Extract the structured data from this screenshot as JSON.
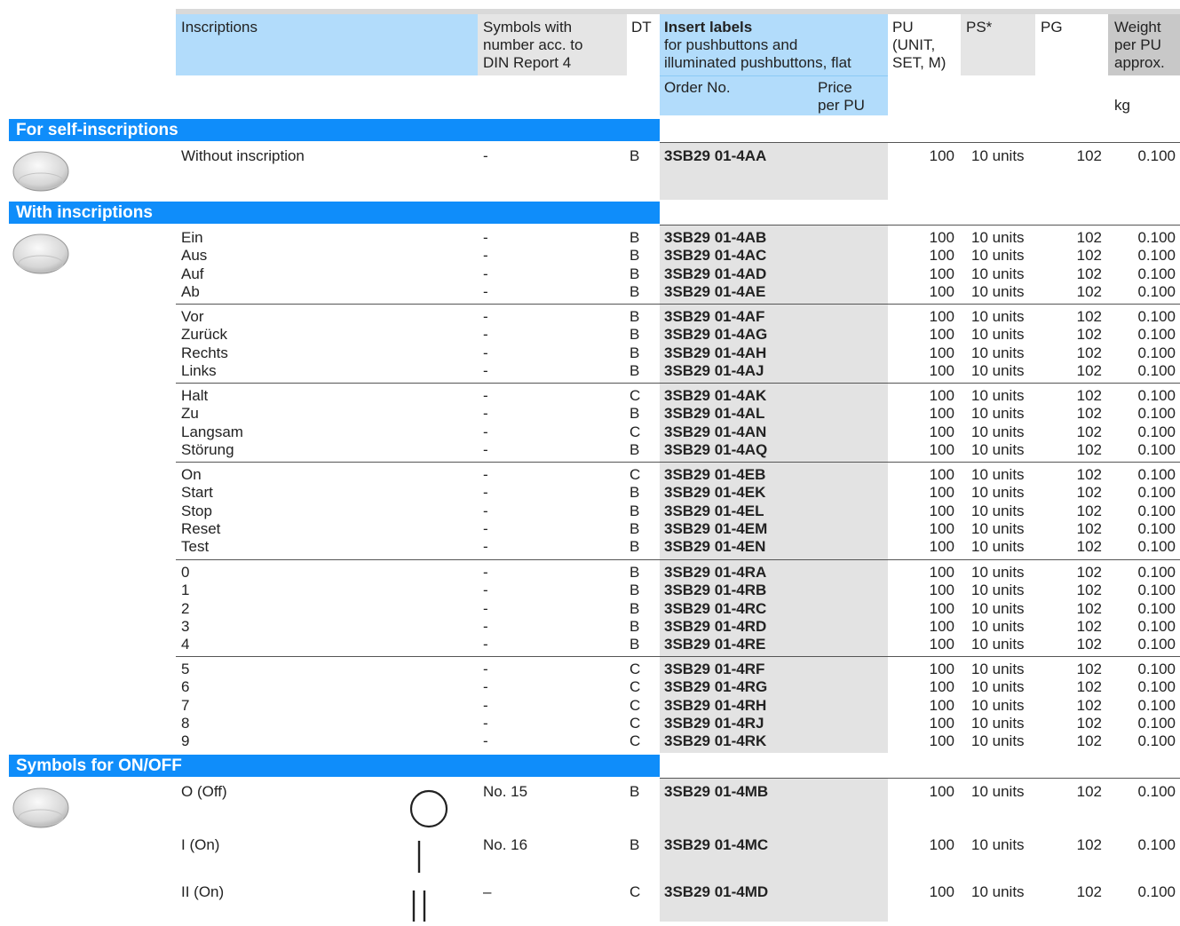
{
  "header": {
    "inscriptions": "Inscriptions",
    "symbols": [
      "Symbols with",
      "number acc. to",
      "DIN Report 4"
    ],
    "dt": "DT",
    "insert_title": "Insert labels",
    "insert_sub": [
      "for pushbuttons and",
      "illuminated pushbuttons, flat"
    ],
    "pu": [
      "PU",
      "(UNIT,",
      "SET, M)"
    ],
    "ps": "PS*",
    "pg": "PG",
    "weight": [
      "Weight",
      "per PU",
      "approx."
    ],
    "order_no": "Order No.",
    "price": [
      "Price",
      "per PU"
    ],
    "kg": "kg"
  },
  "sections": {
    "self": "For self-inscriptions",
    "with": "With inscriptions",
    "symbols": "Symbols for ON/OFF"
  },
  "self_row": {
    "ins": "Without inscription",
    "sym": "-",
    "dt": "B",
    "ord": "3SB29 01-4AA",
    "pu": "100",
    "ps": "10 units",
    "pg": "102",
    "wt": "0.100"
  },
  "groups": [
    [
      {
        "ins": "Ein",
        "sym": "-",
        "dt": "B",
        "ord": "3SB29 01-4AB",
        "pu": "100",
        "ps": "10 units",
        "pg": "102",
        "wt": "0.100"
      },
      {
        "ins": "Aus",
        "sym": "-",
        "dt": "B",
        "ord": "3SB29 01-4AC",
        "pu": "100",
        "ps": "10 units",
        "pg": "102",
        "wt": "0.100"
      },
      {
        "ins": "Auf",
        "sym": "-",
        "dt": "B",
        "ord": "3SB29 01-4AD",
        "pu": "100",
        "ps": "10 units",
        "pg": "102",
        "wt": "0.100"
      },
      {
        "ins": "Ab",
        "sym": "-",
        "dt": "B",
        "ord": "3SB29 01-4AE",
        "pu": "100",
        "ps": "10 units",
        "pg": "102",
        "wt": "0.100"
      }
    ],
    [
      {
        "ins": "Vor",
        "sym": "-",
        "dt": "B",
        "ord": "3SB29 01-4AF",
        "pu": "100",
        "ps": "10 units",
        "pg": "102",
        "wt": "0.100"
      },
      {
        "ins": "Zurück",
        "sym": "-",
        "dt": "B",
        "ord": "3SB29 01-4AG",
        "pu": "100",
        "ps": "10 units",
        "pg": "102",
        "wt": "0.100"
      },
      {
        "ins": "Rechts",
        "sym": "-",
        "dt": "B",
        "ord": "3SB29 01-4AH",
        "pu": "100",
        "ps": "10 units",
        "pg": "102",
        "wt": "0.100"
      },
      {
        "ins": "Links",
        "sym": "-",
        "dt": "B",
        "ord": "3SB29 01-4AJ",
        "pu": "100",
        "ps": "10 units",
        "pg": "102",
        "wt": "0.100"
      }
    ],
    [
      {
        "ins": "Halt",
        "sym": "-",
        "dt": "C",
        "ord": "3SB29 01-4AK",
        "pu": "100",
        "ps": "10 units",
        "pg": "102",
        "wt": "0.100"
      },
      {
        "ins": "Zu",
        "sym": "-",
        "dt": "B",
        "ord": "3SB29 01-4AL",
        "pu": "100",
        "ps": "10 units",
        "pg": "102",
        "wt": "0.100"
      },
      {
        "ins": "Langsam",
        "sym": "-",
        "dt": "C",
        "ord": "3SB29 01-4AN",
        "pu": "100",
        "ps": "10 units",
        "pg": "102",
        "wt": "0.100"
      },
      {
        "ins": "Störung",
        "sym": "-",
        "dt": "B",
        "ord": "3SB29 01-4AQ",
        "pu": "100",
        "ps": "10 units",
        "pg": "102",
        "wt": "0.100"
      }
    ],
    [
      {
        "ins": "On",
        "sym": "-",
        "dt": "C",
        "ord": "3SB29 01-4EB",
        "pu": "100",
        "ps": "10 units",
        "pg": "102",
        "wt": "0.100"
      },
      {
        "ins": "Start",
        "sym": "-",
        "dt": "B",
        "ord": "3SB29 01-4EK",
        "pu": "100",
        "ps": "10 units",
        "pg": "102",
        "wt": "0.100"
      },
      {
        "ins": "Stop",
        "sym": "-",
        "dt": "B",
        "ord": "3SB29 01-4EL",
        "pu": "100",
        "ps": "10 units",
        "pg": "102",
        "wt": "0.100"
      },
      {
        "ins": "Reset",
        "sym": "-",
        "dt": "B",
        "ord": "3SB29 01-4EM",
        "pu": "100",
        "ps": "10 units",
        "pg": "102",
        "wt": "0.100"
      },
      {
        "ins": "Test",
        "sym": "-",
        "dt": "B",
        "ord": "3SB29 01-4EN",
        "pu": "100",
        "ps": "10 units",
        "pg": "102",
        "wt": "0.100"
      }
    ],
    [
      {
        "ins": "0",
        "sym": "-",
        "dt": "B",
        "ord": "3SB29 01-4RA",
        "pu": "100",
        "ps": "10 units",
        "pg": "102",
        "wt": "0.100"
      },
      {
        "ins": "1",
        "sym": "-",
        "dt": "B",
        "ord": "3SB29 01-4RB",
        "pu": "100",
        "ps": "10 units",
        "pg": "102",
        "wt": "0.100"
      },
      {
        "ins": "2",
        "sym": "-",
        "dt": "B",
        "ord": "3SB29 01-4RC",
        "pu": "100",
        "ps": "10 units",
        "pg": "102",
        "wt": "0.100"
      },
      {
        "ins": "3",
        "sym": "-",
        "dt": "B",
        "ord": "3SB29 01-4RD",
        "pu": "100",
        "ps": "10 units",
        "pg": "102",
        "wt": "0.100"
      },
      {
        "ins": "4",
        "sym": "-",
        "dt": "B",
        "ord": "3SB29 01-4RE",
        "pu": "100",
        "ps": "10 units",
        "pg": "102",
        "wt": "0.100"
      }
    ],
    [
      {
        "ins": "5",
        "sym": "-",
        "dt": "C",
        "ord": "3SB29 01-4RF",
        "pu": "100",
        "ps": "10 units",
        "pg": "102",
        "wt": "0.100"
      },
      {
        "ins": "6",
        "sym": "-",
        "dt": "C",
        "ord": "3SB29 01-4RG",
        "pu": "100",
        "ps": "10 units",
        "pg": "102",
        "wt": "0.100"
      },
      {
        "ins": "7",
        "sym": "-",
        "dt": "C",
        "ord": "3SB29 01-4RH",
        "pu": "100",
        "ps": "10 units",
        "pg": "102",
        "wt": "0.100"
      },
      {
        "ins": "8",
        "sym": "-",
        "dt": "C",
        "ord": "3SB29 01-4RJ",
        "pu": "100",
        "ps": "10 units",
        "pg": "102",
        "wt": "0.100"
      },
      {
        "ins": "9",
        "sym": "-",
        "dt": "C",
        "ord": "3SB29 01-4RK",
        "pu": "100",
        "ps": "10 units",
        "pg": "102",
        "wt": "0.100"
      }
    ]
  ],
  "symbol_rows": [
    {
      "ins": "O (Off)",
      "symbol": "circle",
      "sym": "No. 15",
      "dt": "B",
      "ord": "3SB29 01-4MB",
      "pu": "100",
      "ps": "10 units",
      "pg": "102",
      "wt": "0.100"
    },
    {
      "ins": "I (On)",
      "symbol": "bar",
      "sym": "No. 16",
      "dt": "B",
      "ord": "3SB29 01-4MC",
      "pu": "100",
      "ps": "10 units",
      "pg": "102",
      "wt": "0.100"
    },
    {
      "ins": "II (On)",
      "symbol": "double-bar",
      "sym": "–",
      "dt": "C",
      "ord": "3SB29 01-4MD",
      "pu": "100",
      "ps": "10 units",
      "pg": "102",
      "wt": "0.100"
    }
  ]
}
